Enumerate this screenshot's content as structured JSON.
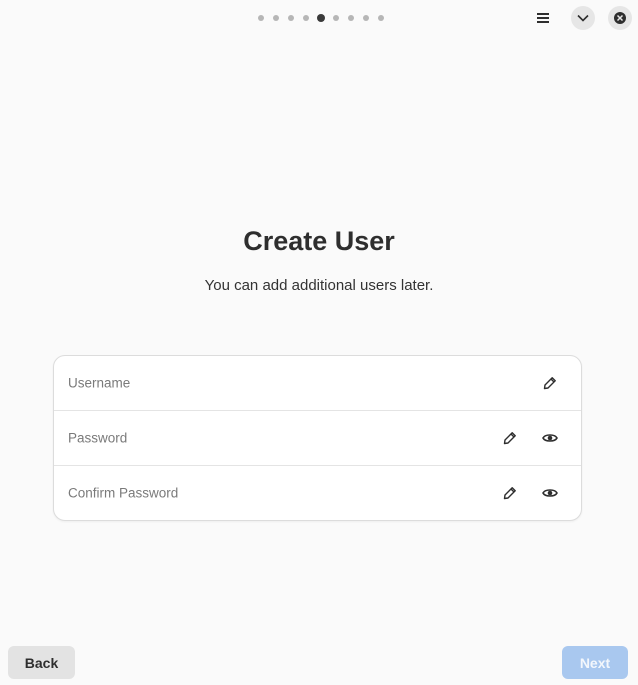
{
  "header": {
    "pager": {
      "total_pages": 9,
      "current_page": 5
    },
    "icons": {
      "menu": "hamburger-menu-icon",
      "minimize": "chevron-down-icon",
      "close": "close-icon"
    }
  },
  "main": {
    "title": "Create User",
    "subtitle": "You can add additional users later."
  },
  "form": {
    "username": {
      "placeholder": "Username",
      "value": ""
    },
    "password": {
      "placeholder": "Password",
      "value": ""
    },
    "confirm_password": {
      "placeholder": "Confirm Password",
      "value": ""
    }
  },
  "footer": {
    "back_label": "Back",
    "next_label": "Next"
  },
  "colors": {
    "accent_disabled": "#a9c8ef",
    "background": "#fafafa"
  }
}
